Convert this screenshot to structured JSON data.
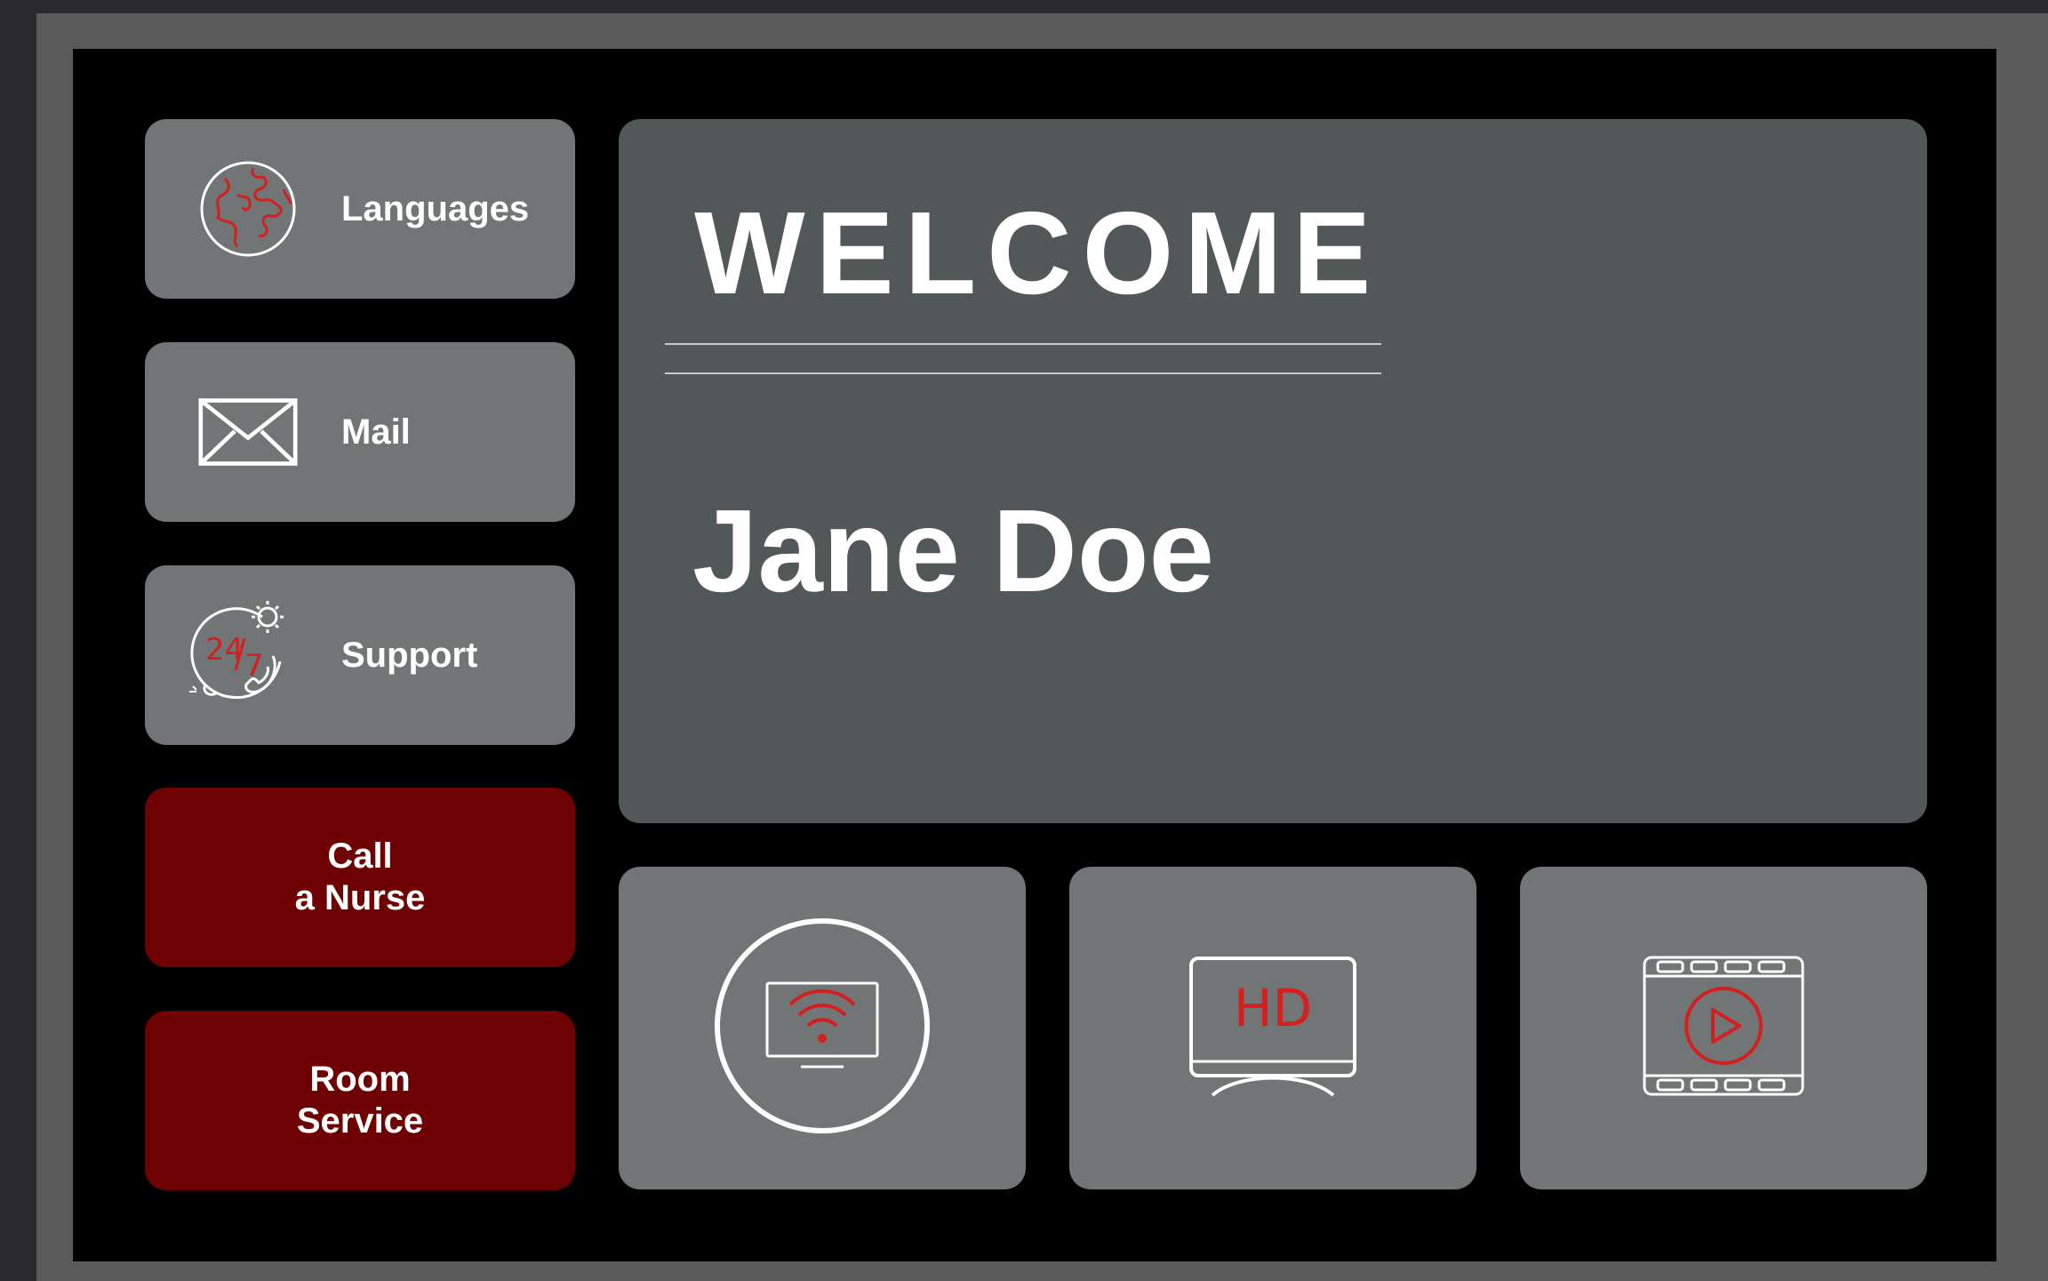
{
  "sidebar": {
    "items": [
      {
        "label": "Languages",
        "icon": "globe-icon"
      },
      {
        "label": "Mail",
        "icon": "envelope-icon"
      },
      {
        "label": "Support",
        "icon": "support-247-icon"
      },
      {
        "label_line1": "Call",
        "label_line2": "a Nurse"
      },
      {
        "label_line1": "Room",
        "label_line2": "Service"
      }
    ]
  },
  "welcome": {
    "title": "WELCOME",
    "guest_name": "Jane Doe"
  },
  "media_tiles": [
    {
      "icon": "wireless-screen-icon"
    },
    {
      "icon": "hd-tv-icon",
      "icon_text": "HD"
    },
    {
      "icon": "video-player-icon"
    }
  ],
  "colors": {
    "accent": "#d41f1f",
    "alert_tile": "#6e0202",
    "tile": "#717576",
    "panel": "#525758"
  }
}
